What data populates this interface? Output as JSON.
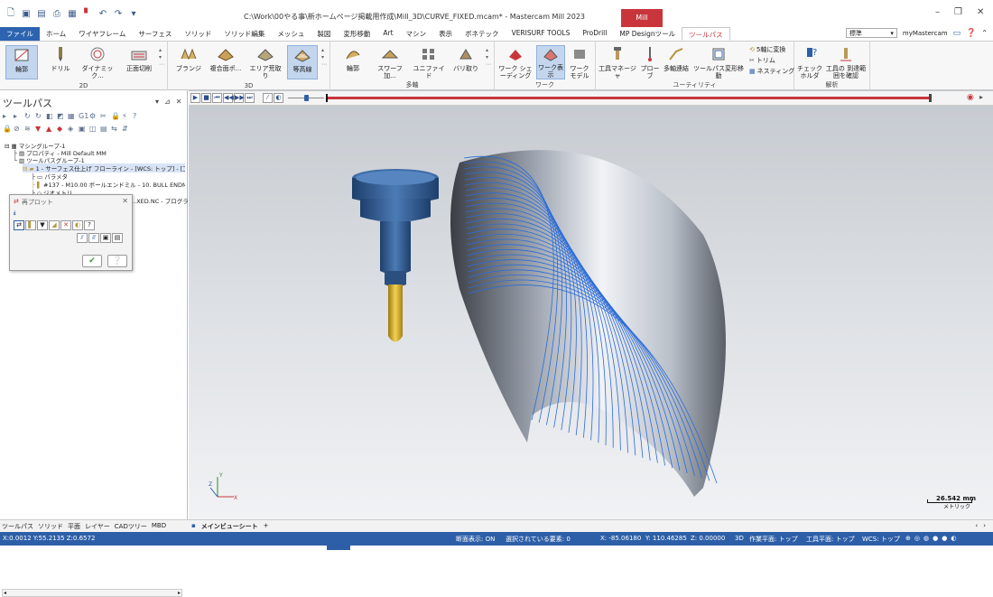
{
  "title_bar": {
    "title": "C:\\Work\\00やる事\\新ホームページ掲載用作成\\Mill_3D\\CURVE_FIXED.mcam* - Mastercam Mill 2023",
    "context_tab": "Mill"
  },
  "tabs": [
    "ファイル",
    "ホーム",
    "ワイヤフレーム",
    "サーフェス",
    "ソリッド",
    "ソリッド編集",
    "メッシュ",
    "製図",
    "変形移動",
    "Art",
    "マシン",
    "表示",
    "ボネテック",
    "VERISURF TOOLS",
    "ProDrill",
    "MP Designツール",
    "ツールパス"
  ],
  "active_tab": "ツールパス",
  "right_controls": {
    "mode": "標準",
    "account": "myMastercam"
  },
  "ribbon": {
    "groups": {
      "g2d": "2D",
      "g3d": "3D",
      "multi": "多軸",
      "work": "ワーク",
      "utility": "ユーティリティ",
      "analysis": "解析"
    },
    "buttons_2d": [
      "輪郭",
      "ドリル",
      "ダイナミック...",
      "正面切削"
    ],
    "buttons_3d": [
      "ブランジ",
      "複合面ポ...",
      "エリア荒取り",
      "等高線"
    ],
    "buttons_multi": [
      "輪郭",
      "スワーフ加...",
      "ユニファイド",
      "バリ取り"
    ],
    "buttons_work": [
      "ワーク シェーディング",
      "ワーク表示",
      "ワーク モデル"
    ],
    "buttons_util": [
      "工具マネージャ",
      "プローブ",
      "多軸連結",
      "ツールパス変形移動"
    ],
    "small_util": [
      "5軸に変換",
      "トリム",
      "ネスティング"
    ],
    "buttons_analysis": [
      "チェック ホルダ",
      "工具の 到達範囲を確認"
    ]
  },
  "left_panel": {
    "title": "ツールパス",
    "tree": [
      "マシングループ-1",
      "プロパティ - Mill Default MM",
      "ツールパスグループ-1",
      "1 - サーフェス仕上げ フローライン - [WCS: トップ] - [工具平面: ...",
      "パラメタ",
      "#137 - M10.00 ボールエンドミル - 10. BULL ENDMIL...",
      "ジオメトリ",
      "...XED.NC - プログラム番...",
      "..."
    ]
  },
  "replot_dialog": {
    "title": "再プロット"
  },
  "viewport": {
    "scale_value": "26.542 mm",
    "scale_unit": "メトリック"
  },
  "bottom_tabs": {
    "left": [
      "ツールパス",
      "ソリッド",
      "平面",
      "レイヤー",
      "CADツリー",
      "MBD"
    ],
    "sheet": "メインビューシート"
  },
  "status_bar": {
    "coords_left": "X:0.0012  Y:55.2135  Z:0.6572",
    "section_view": "断面表示: ON",
    "selected": "選択されている要素: 0",
    "x": "X:  -85.06180",
    "y": "Y:  110.46285",
    "z": "Z:  0.00000",
    "mode": "3D",
    "plane": "作業平面: トップ",
    "tool_plane": "工具平面: トップ",
    "wcs": "WCS: トップ"
  }
}
